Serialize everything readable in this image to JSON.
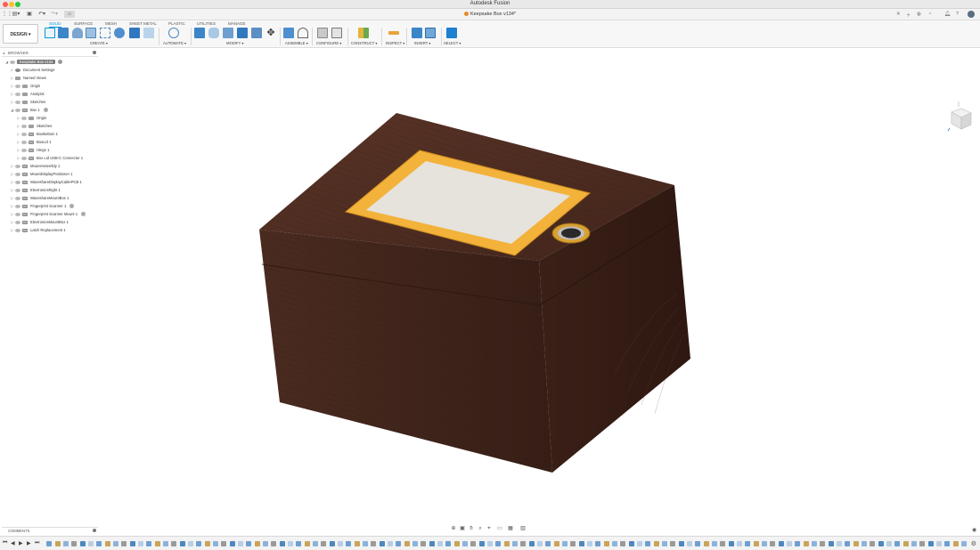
{
  "app": {
    "title": "Autodesk Fusion",
    "document_tab": "Keepsake Box v134*"
  },
  "ribbon": {
    "workspace": "DESIGN ▾",
    "tabs": [
      "SOLID",
      "SURFACE",
      "MESH",
      "SHEET METAL",
      "PLASTIC",
      "UTILITIES",
      "MANAGE"
    ],
    "active_tab": "SOLID",
    "groups": {
      "create": "CREATE ▾",
      "automate": "AUTOMATE ▾",
      "modify": "MODIFY ▾",
      "assemble": "ASSEMBLE ▾",
      "configure": "CONFIGURE ▾",
      "construct": "CONSTRUCT ▾",
      "inspect": "INSPECT ▾",
      "insert": "INSERT ▾",
      "select": "SELECT ▾"
    }
  },
  "browser": {
    "title": "BROWSER",
    "root": "Keepsake Box v134",
    "items": [
      "Document Settings",
      "Named Views",
      "Origin",
      "Analysis",
      "Sketches",
      "Box 1",
      "Origin",
      "Sketches",
      "BoxBottom 1",
      "BoxLid 1",
      "Hinge 1",
      "Box Lid USB-C Connector 1",
      "MountAssembly 1",
      "MountDisplayPositioner 1",
      "WaveshareDisplayCablePCB 1",
      "ElectronicsRight 1",
      "WaveshareMountBox 1",
      "Fingerprint Scanner 1",
      "Fingerprint Scanner Mount 1",
      "ElectronicsMountBox 1",
      "Latch Replacement 1"
    ]
  },
  "comments": {
    "title": "COMMENTS"
  },
  "colors": {
    "accent": "#0696d7",
    "wood_top": "#4a2a20",
    "wood_front": "#3e2219",
    "wood_side": "#341c14",
    "frame": "#f3b23a",
    "screen": "#e6e2dc"
  }
}
